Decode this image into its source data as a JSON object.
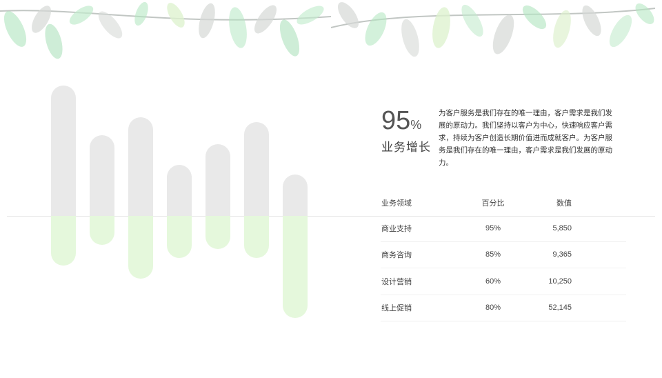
{
  "colors": {
    "bar_gray": "#e9e9e9",
    "bar_green": "#e5f8dc",
    "leaf_green": "#a8e2b8",
    "leaf_gray": "#cfd3d0"
  },
  "decoration": {
    "icon": "watercolor-leaves-icon"
  },
  "bar_chart": {
    "icon": "bar-chart-icon",
    "series": [
      {
        "top_level": 0.82,
        "bottom_level": 0.38
      },
      {
        "top_level": 0.51,
        "bottom_level": 0.22
      },
      {
        "top_level": 0.62,
        "bottom_level": 0.48
      },
      {
        "top_level": 0.32,
        "bottom_level": 0.32
      },
      {
        "top_level": 0.45,
        "bottom_level": 0.25
      },
      {
        "top_level": 0.59,
        "bottom_level": 0.32
      },
      {
        "top_level": 0.26,
        "bottom_level": 0.78
      }
    ]
  },
  "headline": {
    "value": "95",
    "unit": "%",
    "label": "业务增长",
    "description": "为客户服务是我们存在的唯一理由，客户需求是我们发展的原动力。我们坚持以客户为中心，快速响应客户需求，持续为客户创造长期价值进而成就客户。为客户服务是我们存在的唯一理由，客户需求是我们发展的原动力。"
  },
  "table": {
    "headers": [
      "业务领域",
      "百分比",
      "数值"
    ],
    "rows": [
      [
        "商业支持",
        "95%",
        "5,850"
      ],
      [
        "商务咨询",
        "85%",
        "9,365"
      ],
      [
        "设计营销",
        "60%",
        "10,250"
      ],
      [
        "线上促销",
        "80%",
        "52,145"
      ]
    ]
  }
}
